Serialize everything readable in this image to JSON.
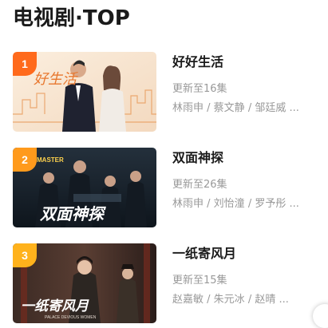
{
  "section": {
    "title": "电视剧·TOP"
  },
  "items": [
    {
      "rank": "1",
      "rank_color": "#ff6a1c",
      "name": "好好生活",
      "update": "更新至16集",
      "cast": [
        "林雨申",
        "蔡文静",
        "邹廷威"
      ],
      "cast_sep": " / ",
      "ellipsis": " ...",
      "poster_text": "好生活"
    },
    {
      "rank": "2",
      "rank_color": "#ff9a1c",
      "name": "双面神探",
      "update": "更新至26集",
      "cast": [
        "林雨申",
        "刘怡潼",
        "罗予彤"
      ],
      "cast_sep": " / ",
      "ellipsis": " ...",
      "poster_top": "MASTER",
      "poster_text": "双面神探"
    },
    {
      "rank": "3",
      "rank_color": "#ffb21c",
      "name": "一纸寄风月",
      "update": "更新至15集",
      "cast": [
        "赵嘉敏",
        "朱元冰",
        "赵晴"
      ],
      "cast_sep": " / ",
      "ellipsis": " ...",
      "poster_text": "一纸寄风月",
      "poster_sub": "PALACE DEVIOUS WOMEN"
    }
  ]
}
